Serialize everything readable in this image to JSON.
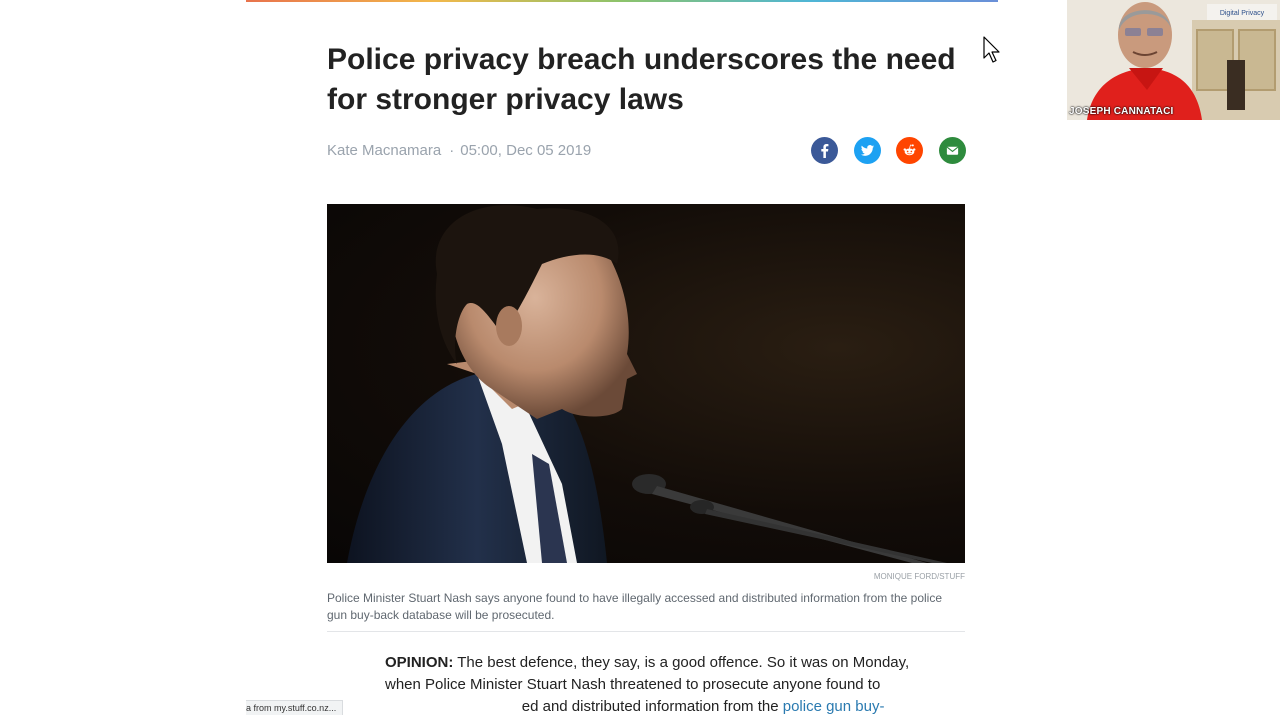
{
  "article": {
    "headline": "Police privacy breach underscores the need for stronger privacy laws",
    "author": "Kate Macnamara",
    "separator": "·",
    "datetime": "05:00, Dec 05 2019",
    "photo_credit": "MONIQUE FORD/STUFF",
    "caption": "Police Minister Stuart Nash says anyone found to have illegally accessed and distributed information from the police gun buy-back database will be prosecuted.",
    "body": {
      "lead_label": "OPINION:",
      "line1": " The best defence, they say, is a good offence. So it was on Monday,",
      "line2": "when Police Minister Stuart Nash threatened to prosecute anyone found to",
      "line3_visible": "ed and distributed information from the ",
      "line3_link": "police gun buy-"
    }
  },
  "share": {
    "facebook_color": "#3b5998",
    "twitter_color": "#1da1f2",
    "reddit_color": "#ff4500",
    "email_color": "#2e8b3d"
  },
  "status_bar": {
    "text": "a from my.stuff.co.nz..."
  },
  "webcam": {
    "name": "JOSEPH CANNATACI",
    "background_sign": "Digital Privacy"
  }
}
